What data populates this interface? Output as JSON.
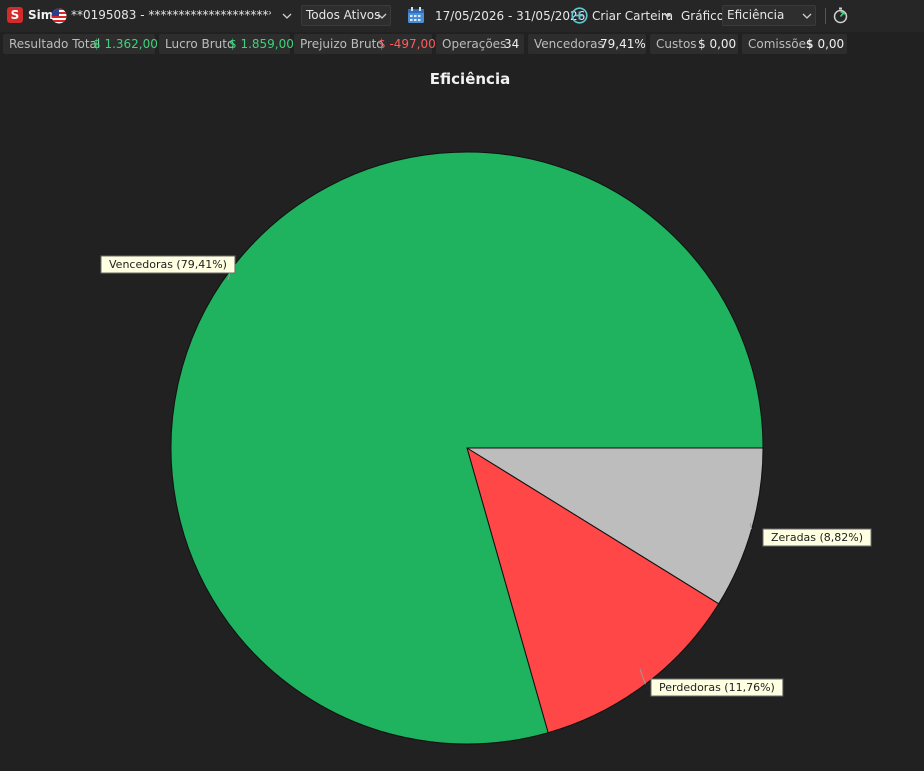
{
  "toolbar": {
    "logo_letter": "S",
    "mode": "Sim",
    "account": "**0195083 - ************************...",
    "assets_filter": "Todos Ativos",
    "date_range": "17/05/2026 - 31/05/2026",
    "create_portfolio": "Criar Carteira",
    "chart_label": "Gráfico",
    "chart_select": "Eficiência"
  },
  "stats": [
    {
      "label": "Resultado Total",
      "value": "$ 1.362,00",
      "tone": "green"
    },
    {
      "label": "Lucro Bruto",
      "value": "$ 1.859,00",
      "tone": "green"
    },
    {
      "label": "Prejuizo Bruto",
      "value": "$ -497,00",
      "tone": "red"
    },
    {
      "label": "Operações",
      "value": "34",
      "tone": "white"
    },
    {
      "label": "Vencedoras",
      "value": "79,41%",
      "tone": "white"
    },
    {
      "label": "Custos",
      "value": "$ 0,00",
      "tone": "white"
    },
    {
      "label": "Comissões",
      "value": "$ 0,00",
      "tone": "white"
    }
  ],
  "icons": {
    "flag": "us-flag-icon",
    "calendar": "calendar-icon",
    "create": "plus-circle-icon",
    "timer": "stopwatch-icon"
  },
  "colors": {
    "winners": "#1fb25f",
    "losers": "#ff4747",
    "zeroed": "#bdbdbd",
    "positive": "#3fd27a",
    "negative": "#ff5c5c"
  },
  "chart_data": {
    "type": "pie",
    "title": "Eficiência",
    "slices": [
      {
        "name": "Zeradas",
        "value": 8.82,
        "label": "Zeradas (8,82%)",
        "color": "#bdbdbd"
      },
      {
        "name": "Perdedoras",
        "value": 11.76,
        "label": "Perdedoras (11,76%)",
        "color": "#ff4747"
      },
      {
        "name": "Vencedoras",
        "value": 79.41,
        "label": "Vencedoras (79,41%)",
        "color": "#1fb25f"
      }
    ]
  }
}
